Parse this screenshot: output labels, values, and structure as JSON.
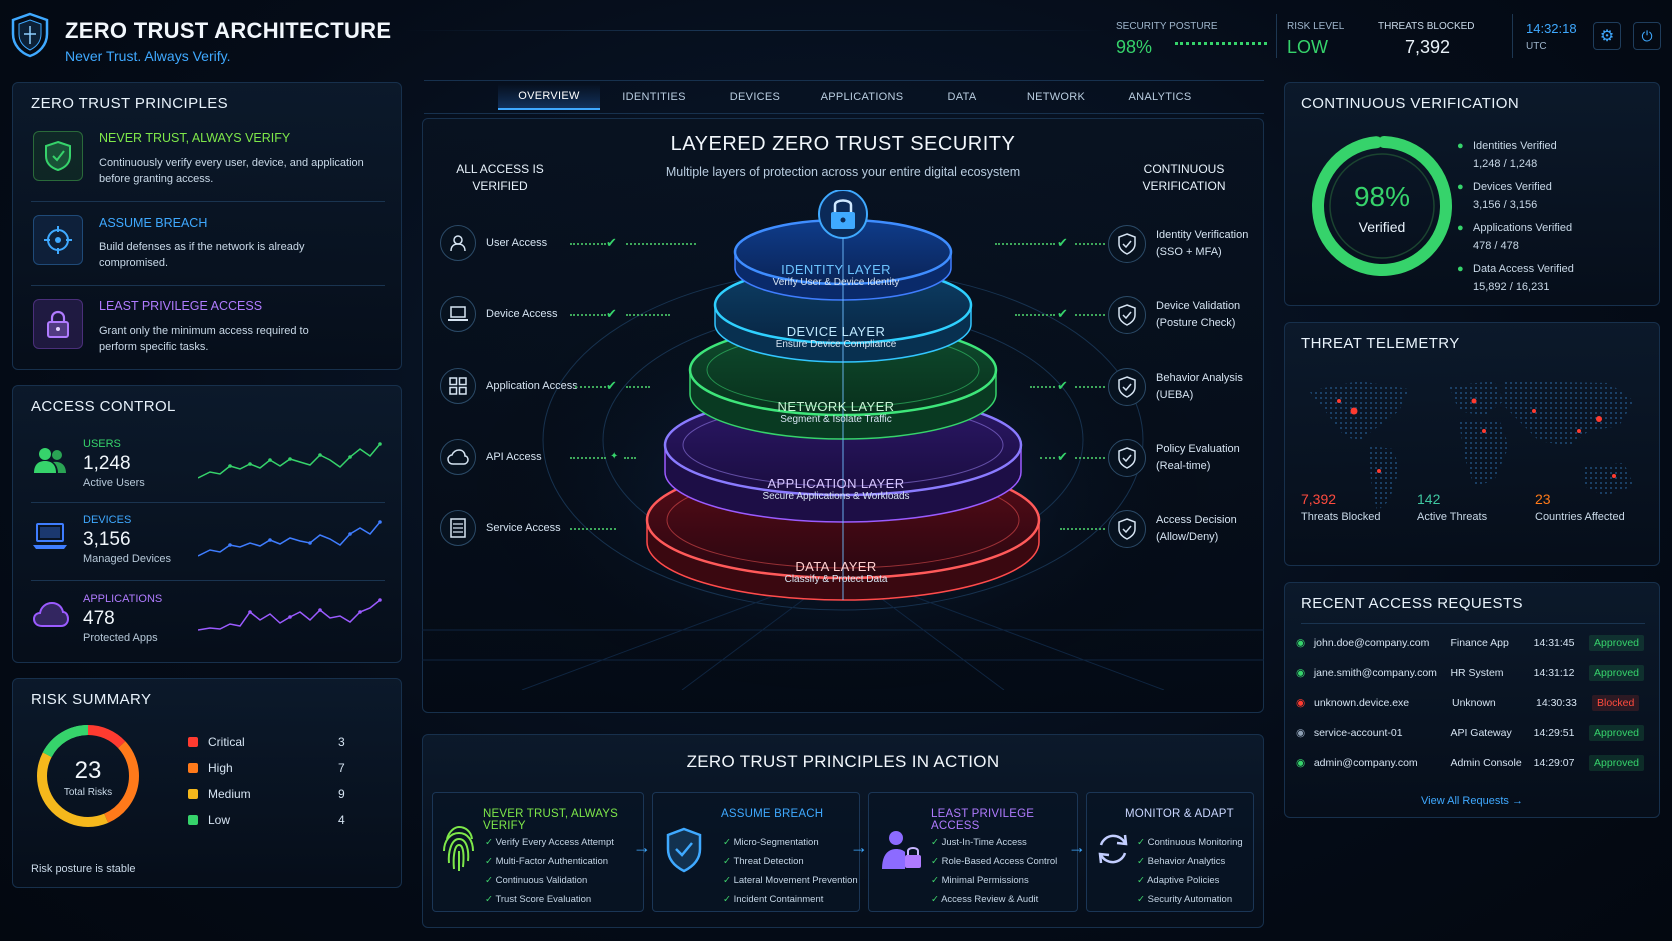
{
  "header": {
    "title": "ZERO TRUST ARCHITECTURE",
    "subtitle": "Never Trust. Always Verify.",
    "posture_label": "SECURITY POSTURE",
    "posture_value": "98%",
    "risk_label": "RISK LEVEL",
    "risk_value": "LOW",
    "threats_label": "THREATS BLOCKED",
    "threats_value": "7,392",
    "time": "14:32:18",
    "tz": "UTC"
  },
  "principles": {
    "title": "ZERO TRUST PRINCIPLES",
    "items": [
      {
        "title": "NEVER TRUST, ALWAYS VERIFY",
        "desc1": "Continuously verify every user, device, and application",
        "desc2": "before granting access."
      },
      {
        "title": "ASSUME BREACH",
        "desc1": "Build defenses as if the network is already",
        "desc2": "compromised."
      },
      {
        "title": "LEAST PRIVILEGE ACCESS",
        "desc1": "Grant only the minimum access required to",
        "desc2": "perform specific tasks."
      }
    ]
  },
  "access_control": {
    "title": "ACCESS CONTROL",
    "items": [
      {
        "label": "USERS",
        "value": "1,248",
        "sub": "Active Users",
        "color": "#36d36b"
      },
      {
        "label": "DEVICES",
        "value": "3,156",
        "sub": "Managed Devices",
        "color": "#3f7dff"
      },
      {
        "label": "APPLICATIONS",
        "value": "478",
        "sub": "Protected Apps",
        "color": "#9b5bff"
      }
    ]
  },
  "risk": {
    "title": "RISK SUMMARY",
    "total": "23",
    "total_label": "Total Risks",
    "status": "Risk posture is stable",
    "items": [
      {
        "label": "Critical",
        "value": "3",
        "color": "#ff3b30"
      },
      {
        "label": "High",
        "value": "7",
        "color": "#ff7a1a"
      },
      {
        "label": "Medium",
        "value": "9",
        "color": "#f5b81c"
      },
      {
        "label": "Low",
        "value": "4",
        "color": "#36d36b"
      }
    ]
  },
  "tabs": [
    "OVERVIEW",
    "IDENTITIES",
    "DEVICES",
    "APPLICATIONS",
    "DATA",
    "NETWORK",
    "ANALYTICS"
  ],
  "center": {
    "title": "LAYERED ZERO TRUST SECURITY",
    "subtitle": "Multiple layers of protection across your entire digital ecosystem",
    "left_heading1": "ALL ACCESS IS",
    "left_heading2": "VERIFIED",
    "right_heading1": "CONTINUOUS",
    "right_heading2": "VERIFICATION",
    "access": [
      "User Access",
      "Device Access",
      "Application Access",
      "API Access",
      "Service Access"
    ],
    "layers": [
      {
        "title": "IDENTITY LAYER",
        "sub": "Verify User & Device Identity",
        "color": "#3fa9ff"
      },
      {
        "title": "DEVICE LAYER",
        "sub": "Ensure Device Compliance",
        "color": "#62c8ff"
      },
      {
        "title": "NETWORK LAYER",
        "sub": "Segment & Isolate Traffic",
        "color": "#7ee89a"
      },
      {
        "title": "APPLICATION LAYER",
        "sub": "Secure Applications & Workloads",
        "color": "#b98cff"
      },
      {
        "title": "DATA LAYER",
        "sub": "Classify & Protect Data",
        "color": "#ff8f8f"
      }
    ],
    "verifications": [
      {
        "l1": "Identity Verification",
        "l2": "(SSO + MFA)"
      },
      {
        "l1": "Device Validation",
        "l2": "(Posture Check)"
      },
      {
        "l1": "Behavior Analysis",
        "l2": "(UEBA)"
      },
      {
        "l1": "Policy Evaluation",
        "l2": "(Real-time)"
      },
      {
        "l1": "Access Decision",
        "l2": "(Allow/Deny)"
      }
    ]
  },
  "continuous": {
    "title": "CONTINUOUS VERIFICATION",
    "percent": "98%",
    "percent_value": 98,
    "verified": "Verified",
    "items": [
      {
        "label": "Identities Verified",
        "value": "1,248 / 1,248"
      },
      {
        "label": "Devices Verified",
        "value": "3,156 / 3,156"
      },
      {
        "label": "Applications Verified",
        "value": "478 / 478"
      },
      {
        "label": "Data Access Verified",
        "value": "15,892 / 16,231"
      }
    ]
  },
  "telemetry": {
    "title": "THREAT TELEMETRY",
    "stats": [
      {
        "value": "7,392",
        "label": "Threats Blocked",
        "color": "#ff4b3e"
      },
      {
        "value": "142",
        "label": "Active Threats",
        "color": "#3fc7a0"
      },
      {
        "value": "23",
        "label": "Countries Affected",
        "color": "#ff7a1a"
      }
    ]
  },
  "requests": {
    "title": "RECENT ACCESS REQUESTS",
    "link": "View All Requests →",
    "rows": [
      {
        "user": "john.doe@company.com",
        "app": "Finance App",
        "time": "14:31:45",
        "status": "Approved",
        "ok": true
      },
      {
        "user": "jane.smith@company.com",
        "app": "HR System",
        "time": "14:31:12",
        "status": "Approved",
        "ok": true
      },
      {
        "user": "unknown.device.exe",
        "app": "Unknown",
        "time": "14:30:33",
        "status": "Blocked",
        "ok": false
      },
      {
        "user": "service-account-01",
        "app": "API Gateway",
        "time": "14:29:51",
        "status": "Approved",
        "ok": true
      },
      {
        "user": "admin@company.com",
        "app": "Admin Console",
        "time": "14:29:07",
        "status": "Approved",
        "ok": true
      }
    ]
  },
  "action": {
    "title": "ZERO TRUST PRINCIPLES IN ACTION",
    "cards": [
      {
        "title": "NEVER TRUST, ALWAYS VERIFY",
        "color": "#7ee84a",
        "items": [
          "Verify Every Access Attempt",
          "Multi-Factor Authentication",
          "Continuous Validation",
          "Trust Score Evaluation"
        ]
      },
      {
        "title": "ASSUME BREACH",
        "color": "#3fa9ff",
        "items": [
          "Micro-Segmentation",
          "Threat Detection",
          "Lateral Movement Prevention",
          "Incident Containment"
        ]
      },
      {
        "title": "LEAST PRIVILEGE ACCESS",
        "color": "#b07bff",
        "items": [
          "Just-In-Time Access",
          "Role-Based Access Control",
          "Minimal Permissions",
          "Access Review & Audit"
        ]
      },
      {
        "title": "MONITOR & ADAPT",
        "color": "#b8c8ff",
        "items": [
          "Continuous Monitoring",
          "Behavior Analytics",
          "Adaptive Policies",
          "Security Automation"
        ]
      }
    ]
  }
}
